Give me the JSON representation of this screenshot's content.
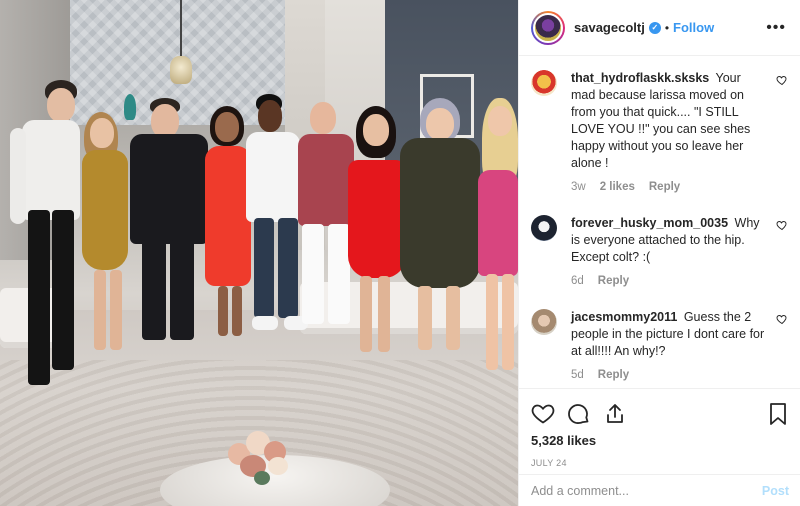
{
  "photo": {
    "description_icon": "post-photo"
  },
  "header": {
    "username": "savagecoltj",
    "verified_icon": "verified-badge-icon",
    "separator": "•",
    "follow_label": "Follow",
    "more_icon": "more-options-icon"
  },
  "comments": [
    {
      "user": "that_hydroflaskk.sksks",
      "text": "Your mad because larissa moved on from you that quick.... \"I STILL LOVE YOU !!\" you can see shes happy without you so leave her alone !",
      "age": "3w",
      "likes": "2 likes",
      "reply": "Reply"
    },
    {
      "user": "forever_husky_mom_0035",
      "text": "Why is everyone attached to the hip. Except colt? :(",
      "age": "6d",
      "reply": "Reply"
    },
    {
      "user": "jacesmommy2011",
      "text": "Guess the 2 people in the picture I dont care for at all!!!! An why!?",
      "age": "5d",
      "reply": "Reply"
    }
  ],
  "actions": {
    "like_icon": "heart-icon",
    "comment_icon": "comment-icon",
    "share_icon": "share-icon",
    "save_icon": "bookmark-icon",
    "likes_count": "5,328 likes",
    "date": "JULY 24"
  },
  "compose": {
    "placeholder": "Add a comment...",
    "post_label": "Post"
  },
  "colors": {
    "link_blue": "#3897f0",
    "muted": "#8e8e8e",
    "post_disabled": "#b2dffc"
  }
}
